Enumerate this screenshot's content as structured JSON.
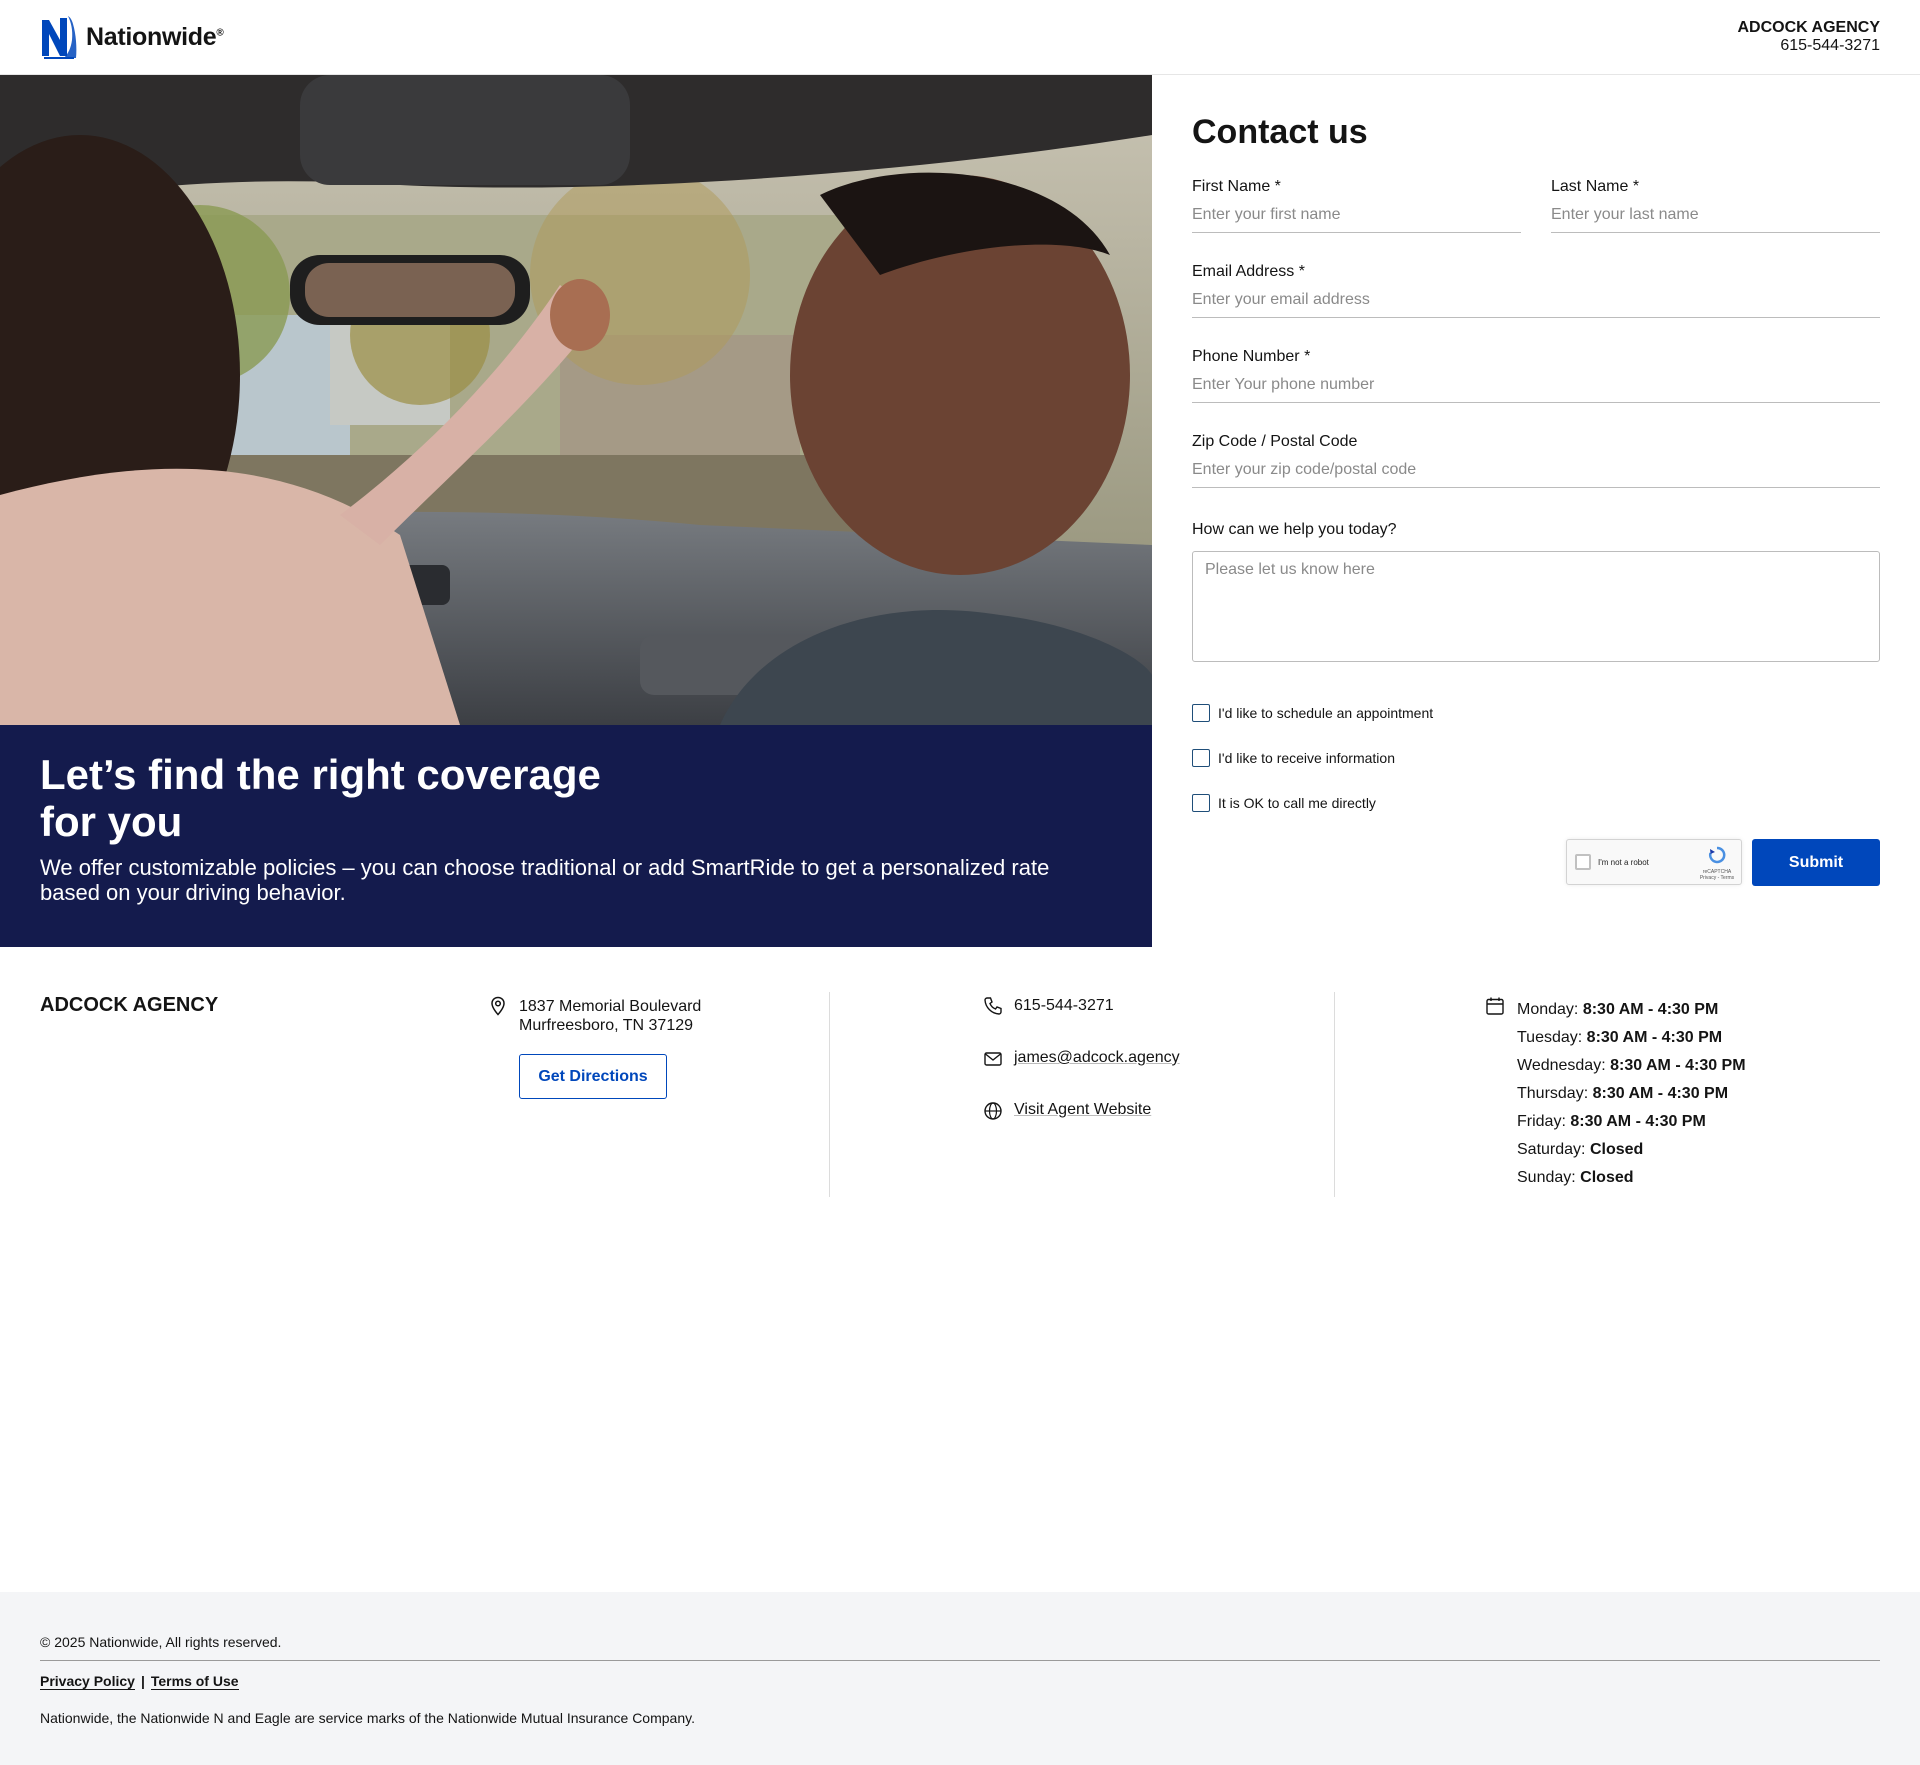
{
  "brand": {
    "logo_text": "Nationwide",
    "reg_mark": "®",
    "color": "#0047bb"
  },
  "header": {
    "agency_name": "ADCOCK AGENCY",
    "phone": "615-544-3271"
  },
  "hero": {
    "image_alt": "Woman adjusting rearview mirror in car beside man",
    "title": "Let’s find the right coverage for you",
    "subtitle": "We offer customizable policies – you can choose traditional or add SmartRide to get a personalized rate based on your driving behavior.",
    "banner_color": "#141b4d"
  },
  "form": {
    "title": "Contact us",
    "first_name": {
      "label": "First Name *",
      "placeholder": "Enter your first name",
      "value": ""
    },
    "last_name": {
      "label": "Last Name *",
      "placeholder": "Enter your last name",
      "value": ""
    },
    "email": {
      "label": "Email Address *",
      "placeholder": "Enter your email address",
      "value": ""
    },
    "phone": {
      "label": "Phone Number *",
      "placeholder": "Enter Your phone number",
      "value": ""
    },
    "zip": {
      "label": "Zip Code / Postal Code",
      "placeholder": "Enter your zip code/postal code",
      "value": ""
    },
    "help": {
      "label": "How can we help you today?",
      "placeholder": "Please let us know here",
      "value": ""
    },
    "checkboxes": [
      {
        "label": "I'd like to schedule an appointment",
        "checked": false
      },
      {
        "label": "I'd like to receive information",
        "checked": false
      },
      {
        "label": "It is OK to call me directly",
        "checked": false
      }
    ],
    "recaptcha": {
      "label": "I'm not a robot",
      "brand": "reCAPTCHA",
      "links": "Privacy - Terms"
    },
    "submit_label": "Submit"
  },
  "info": {
    "agency_name": "ADCOCK AGENCY",
    "address_line1": "1837 Memorial Boulevard",
    "address_line2": "Murfreesboro, TN 37129",
    "directions_label": "Get Directions",
    "phone": "615-544-3271",
    "email": "james@adcock.agency",
    "website_label": "Visit Agent Website",
    "hours": [
      {
        "day": "Monday:",
        "time": "8:30 AM - 4:30 PM"
      },
      {
        "day": "Tuesday:",
        "time": "8:30 AM - 4:30 PM"
      },
      {
        "day": "Wednesday:",
        "time": "8:30 AM - 4:30 PM"
      },
      {
        "day": "Thursday:",
        "time": "8:30 AM - 4:30 PM"
      },
      {
        "day": "Friday:",
        "time": "8:30 AM - 4:30 PM"
      },
      {
        "day": "Saturday:",
        "time": "Closed"
      },
      {
        "day": "Sunday:",
        "time": "Closed"
      }
    ]
  },
  "footer": {
    "copyright": "© 2025 Nationwide, All rights reserved.",
    "privacy_label": "Privacy Policy",
    "separator": "|",
    "terms_label": "Terms of Use",
    "legal": "Nationwide, the Nationwide N and Eagle are service marks of the Nationwide Mutual Insurance Company."
  }
}
